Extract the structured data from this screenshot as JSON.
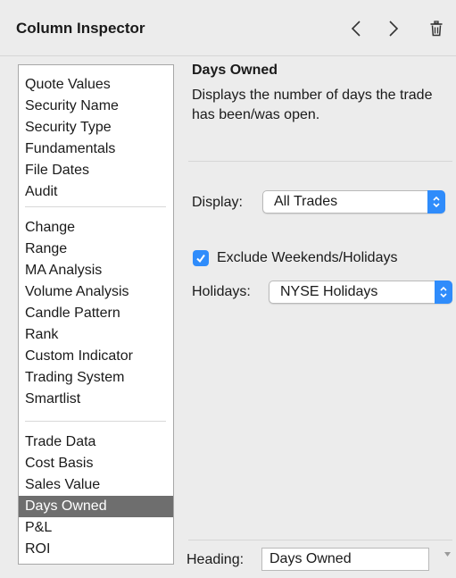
{
  "panel": {
    "title": "Column Inspector"
  },
  "icons": {
    "back": "chevron-left-icon",
    "forward": "chevron-right-icon",
    "delete": "trash-icon",
    "popup": "up-down-chevron-icon",
    "check": "checkmark-icon",
    "heading_menu": "down-arrow-icon"
  },
  "categories": {
    "group1": [
      "Quote Values",
      "Security Name",
      "Security Type",
      "Fundamentals",
      "File Dates",
      "Audit"
    ],
    "group2": [
      "Change",
      "Range",
      "MA Analysis",
      "Volume Analysis",
      "Candle Pattern",
      "Rank",
      "Custom Indicator",
      "Trading System",
      "Smartlist"
    ],
    "group3": [
      "Trade Data",
      "Cost Basis",
      "Sales Value",
      "Days Owned",
      "P&L",
      "ROI"
    ],
    "selected": "Days Owned"
  },
  "description": {
    "title": "Days Owned",
    "text": "Displays the number of days the trade has been/was open."
  },
  "display": {
    "label": "Display:",
    "value": "All Trades"
  },
  "exclude": {
    "label": "Exclude Weekends/Holidays",
    "checked": true
  },
  "holidays": {
    "label": "Holidays:",
    "value": "NYSE Holidays"
  },
  "heading": {
    "label": "Heading:",
    "value": "Days Owned"
  },
  "colors": {
    "accent": "#2f8cfb",
    "selection": "#6e6e6e",
    "background": "#ececec"
  }
}
